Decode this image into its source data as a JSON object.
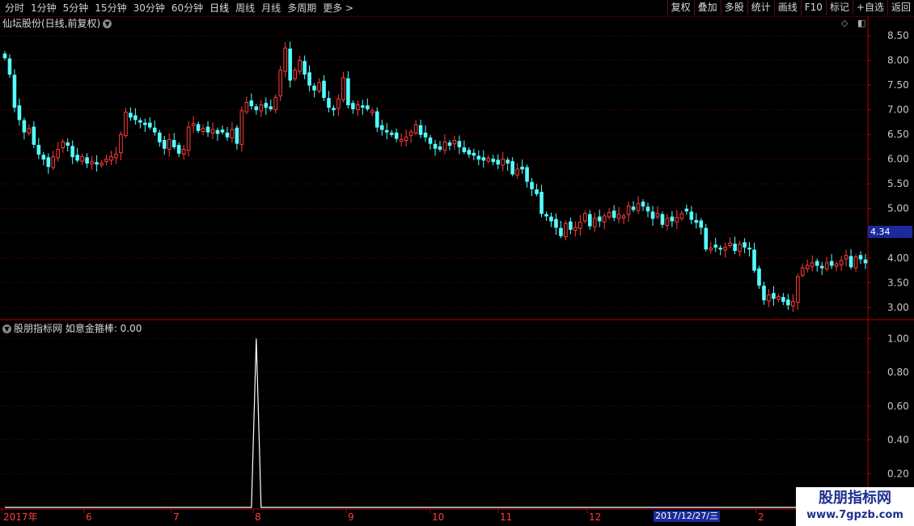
{
  "toolbar": {
    "periods": [
      "分时",
      "1分钟",
      "5分钟",
      "15分钟",
      "30分钟",
      "60分钟",
      "日线",
      "周线",
      "月线",
      "多周期",
      "更多 >"
    ],
    "active_period": "日线",
    "buttons": [
      "复权",
      "叠加",
      "多股",
      "统计",
      "画线",
      "F10",
      "标记",
      "+自选",
      "返回"
    ]
  },
  "main_chart": {
    "title": "仙坛股份(日线,前复权)",
    "current_price_label": "4.34",
    "y_ticks": [
      "8.50",
      "8.00",
      "7.50",
      "7.00",
      "6.50",
      "6.00",
      "5.50",
      "5.00",
      "4.50",
      "4.00",
      "3.50",
      "3.00"
    ]
  },
  "indicator": {
    "title": "股朋指标网  如意金箍棒: 0.00",
    "y_ticks": [
      "1.00",
      "0.80",
      "0.60",
      "0.40",
      "0.20"
    ]
  },
  "x_axis": {
    "labels": [
      "2017年",
      "6",
      "7",
      "8",
      "9",
      "10",
      "11",
      "12",
      "2017/12/27/三",
      "2"
    ],
    "highlighted_date": "2017/12/27/三"
  },
  "watermark": {
    "line1": "股朋指标网",
    "line2": "www.7gpzb.com"
  },
  "colors": {
    "up": "#ff3c3c",
    "down": "#54ffff",
    "grid": "#7a0000",
    "axis": "#b00000",
    "line": "#ffffff",
    "price_tag": "#1a2a9a"
  },
  "chart_data": {
    "type": "candlestick",
    "y_range": [
      2.8,
      8.6
    ],
    "indicator_range": [
      0.0,
      1.05
    ],
    "closes": [
      8.05,
      7.72,
      7.05,
      6.8,
      6.55,
      6.62,
      6.3,
      6.1,
      6.0,
      5.85,
      6.05,
      6.2,
      6.35,
      6.28,
      6.05,
      5.98,
      6.05,
      5.92,
      5.95,
      5.9,
      5.92,
      6.0,
      6.05,
      6.1,
      6.5,
      6.95,
      6.85,
      6.8,
      6.75,
      6.7,
      6.65,
      6.55,
      6.35,
      6.22,
      6.4,
      6.25,
      6.12,
      6.2,
      6.65,
      6.72,
      6.58,
      6.62,
      6.55,
      6.6,
      6.52,
      6.55,
      6.45,
      6.6,
      6.32,
      6.98,
      7.15,
      7.08,
      7.0,
      7.1,
      7.05,
      7.02,
      7.25,
      7.8,
      8.25,
      7.6,
      7.8,
      8.0,
      7.72,
      7.5,
      7.4,
      7.55,
      7.25,
      7.05,
      7.0,
      7.22,
      7.65,
      7.1,
      7.02,
      7.1,
      7.05,
      7.02,
      6.98,
      6.65,
      6.6,
      6.55,
      6.5,
      6.42,
      6.4,
      6.45,
      6.55,
      6.7,
      6.5,
      6.45,
      6.32,
      6.22,
      6.2,
      6.35,
      6.28,
      6.38,
      6.25,
      6.15,
      6.1,
      6.08,
      6.0,
      5.98,
      6.02,
      5.95,
      5.9,
      6.0,
      5.92,
      5.7,
      5.8,
      5.8,
      5.55,
      5.4,
      5.3,
      4.9,
      4.85,
      4.75,
      4.62,
      4.45,
      4.7,
      4.58,
      4.62,
      4.72,
      4.9,
      4.65,
      4.8,
      4.75,
      4.85,
      4.92,
      4.82,
      4.88,
      4.85,
      5.05,
      4.98,
      5.1,
      5.05,
      4.95,
      4.8,
      4.9,
      4.68,
      4.8,
      4.75,
      4.82,
      4.9,
      4.95,
      4.78,
      4.72,
      4.62,
      4.18,
      4.2,
      4.22,
      4.18,
      4.22,
      4.3,
      4.15,
      4.28,
      4.22,
      4.18,
      3.75,
      3.45,
      3.15,
      3.25,
      3.18,
      3.22,
      3.12,
      3.05,
      3.12,
      3.62,
      3.8,
      3.85,
      3.9,
      3.85,
      3.8,
      3.9,
      3.85,
      3.88,
      3.95,
      4.05,
      3.82,
      4.02,
      3.98,
      3.9
    ],
    "signal": {
      "index": 52,
      "value": 1.0
    }
  }
}
